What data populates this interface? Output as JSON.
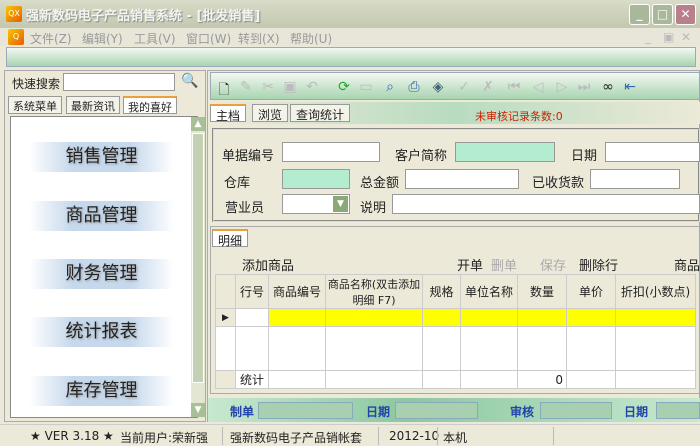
{
  "window": {
    "title": "强新数码电子产品销售系统 - [批发销售]",
    "logo": "QX"
  },
  "menu": [
    "文件(Z)",
    "编辑(Y)",
    "工具(V)",
    "窗口(W)",
    "转到(X)",
    "帮助(U)"
  ],
  "left": {
    "search_label": "快速搜索",
    "search_value": "",
    "tabs": [
      "系统菜单",
      "最新资讯",
      "我的喜好"
    ],
    "active_tab": 2,
    "items": [
      "销售管理",
      "商品管理",
      "财务管理",
      "统计报表",
      "库存管理"
    ]
  },
  "toolbar_icons": [
    "new-icon",
    "edit-icon",
    "delete-icon",
    "save-icon",
    "undo-icon",
    "refresh-icon",
    "print-preview-icon",
    "search-icon",
    "print-icon",
    "export-icon",
    "audit-icon",
    "unaudit-icon",
    "first-icon",
    "prev-icon",
    "next-icon",
    "last-icon",
    "glasses-icon",
    "exit-icon"
  ],
  "tabs": [
    "主档",
    "浏览",
    "查询统计"
  ],
  "unaudited": "未审核记录条数:0",
  "unaudited_color": "#cc2200",
  "form": {
    "doc_no": "单据编号",
    "customer": "客户简称",
    "date": "日期",
    "warehouse": "仓库",
    "total": "总金额",
    "received": "已收货款",
    "salesman": "营业员",
    "remark": "说明"
  },
  "detail": {
    "tab": "明细",
    "add": "添加商品",
    "open": "开单",
    "delete": "删单",
    "save": "保存",
    "delete_row": "删除行",
    "goods": "商品",
    "columns": [
      "行号",
      "商品编号",
      "商品名称(双击添加明细 F7)",
      "规格",
      "单位名称",
      "数量",
      "单价",
      "折扣(小数点)"
    ],
    "stats_label": "统计",
    "qty_total": "0"
  },
  "footer": {
    "maker": "制单",
    "date1": "日期",
    "audit": "审核",
    "date2": "日期"
  },
  "status": {
    "version": "★ VER 3.18 ★",
    "user": "当前用户:荣新强",
    "account": "强新数码电子产品销帐套",
    "period": "2012-10",
    "host": "本机"
  }
}
